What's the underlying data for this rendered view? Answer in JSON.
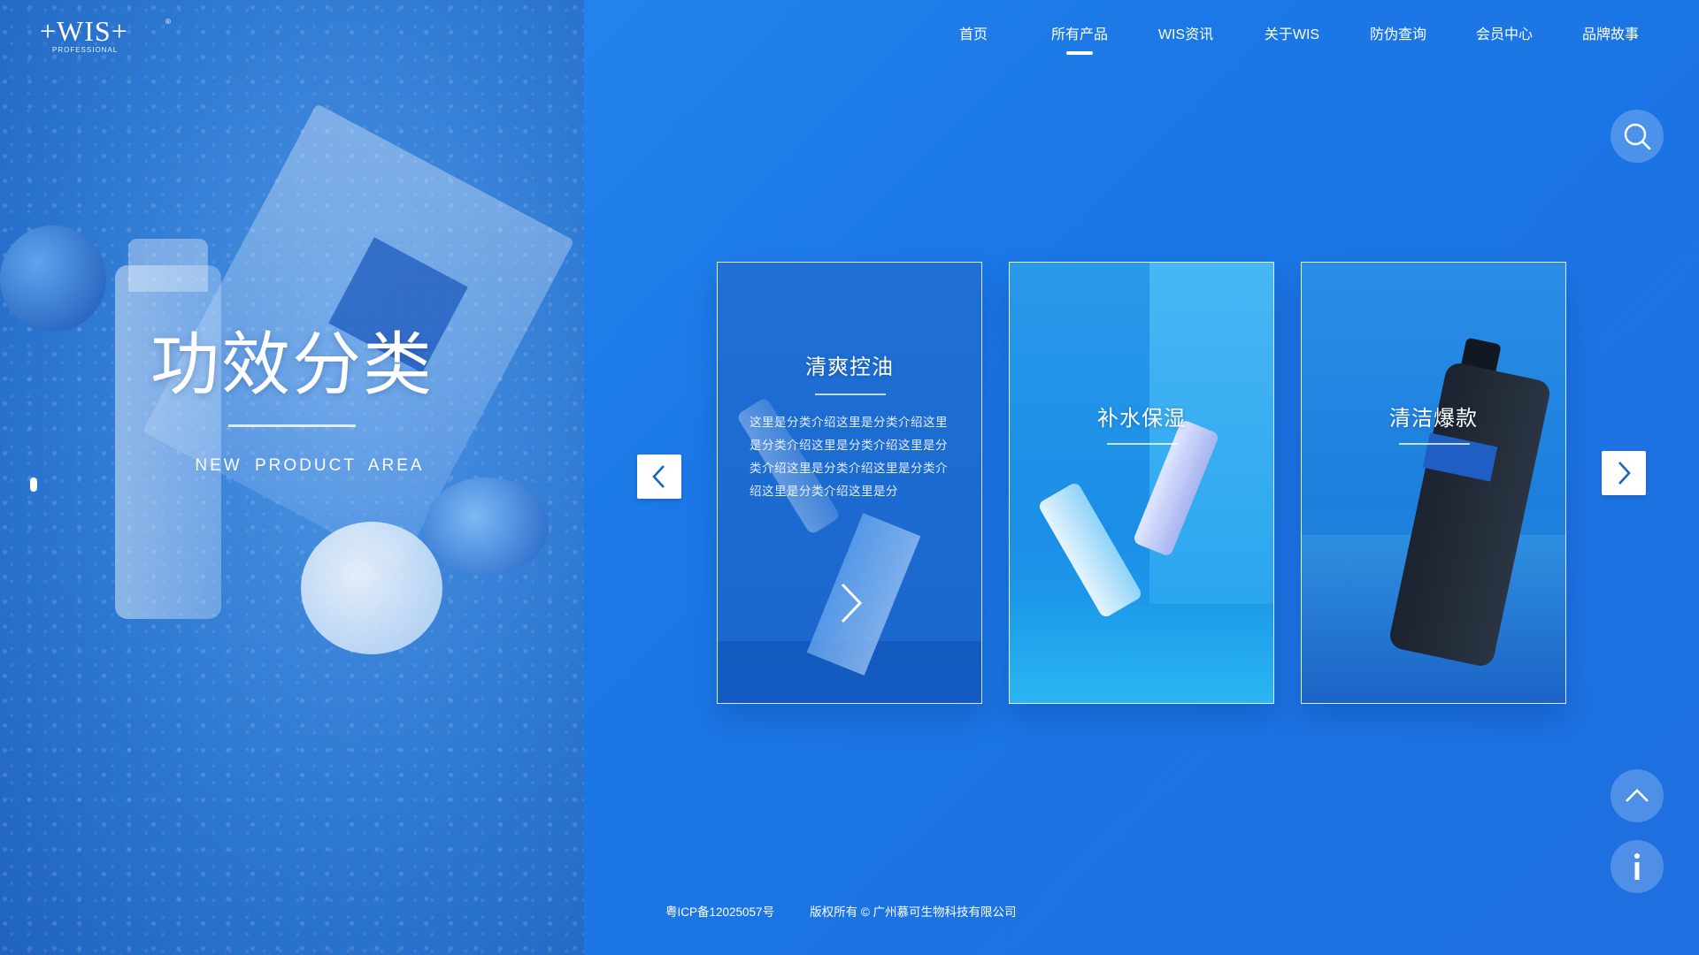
{
  "brand": {
    "logo_text": "+WIS+",
    "logo_sub": "PROFESSIONAL",
    "logo_reg": "®"
  },
  "nav": {
    "items": [
      {
        "label": "首页"
      },
      {
        "label": "所有产品",
        "active": true
      },
      {
        "label": "WIS资讯"
      },
      {
        "label": "关于WIS"
      },
      {
        "label": "防伪查询"
      },
      {
        "label": "会员中心"
      },
      {
        "label": "品牌故事"
      }
    ]
  },
  "hero": {
    "title": "功效分类",
    "subtitle": "NEW PRODUCT AREA"
  },
  "cards": [
    {
      "title": "清爽控油",
      "description": "这里是分类介绍这里是分类介绍这里是分类介绍这里是分类介绍这里是分类介绍这里是分类介绍这里是分类介绍这里是分类介绍这里是分"
    },
    {
      "title": "补水保湿"
    },
    {
      "title": "清洁爆款"
    }
  ],
  "footer": {
    "icp": "粤ICP备12025057号",
    "copyright": "版权所有 © 广州慕可生物科技有限公司"
  },
  "icons": {
    "search": "search-icon",
    "prev": "chevron-left-icon",
    "next": "chevron-right-icon",
    "top": "chevron-up-icon",
    "info": "info-icon"
  },
  "colors": {
    "background": "#1f78e4",
    "left_panel": "#2d78d2",
    "accent": "#ffffff",
    "arrow": "#1f63bf"
  }
}
